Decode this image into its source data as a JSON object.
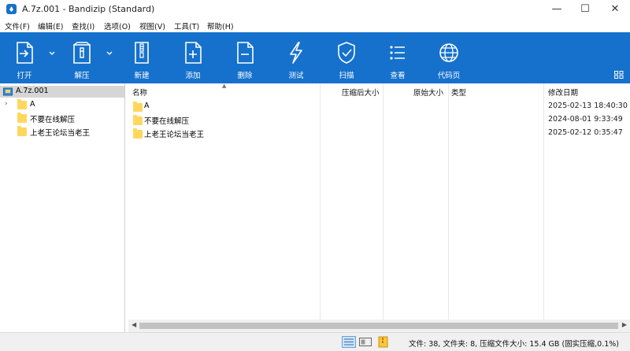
{
  "window": {
    "title": "A.7z.001 - Bandizip (Standard)",
    "minimize": "—",
    "maximize": "☐",
    "close": "✕"
  },
  "menu": [
    "文件(F)",
    "编辑(E)",
    "查找(I)",
    "选项(O)",
    "视图(V)",
    "工具(T)",
    "帮助(H)"
  ],
  "toolbar": {
    "open": "打开",
    "extract": "解压",
    "new": "新建",
    "add": "添加",
    "delete": "删除",
    "test": "测试",
    "scan": "扫描",
    "view": "查看",
    "codepage": "代码页"
  },
  "tree": {
    "root": "A.7z.001",
    "items": [
      "A",
      "不要在线解压",
      "上老王论坛当老王"
    ]
  },
  "columns": {
    "name": "名称",
    "compressed": "压缩后大小",
    "original": "原始大小",
    "type": "类型",
    "modified": "修改日期"
  },
  "files": [
    {
      "name": "A",
      "modified": "2025-02-13 18:40:30"
    },
    {
      "name": "不要在线解压",
      "modified": "2024-08-01 9:33:49"
    },
    {
      "name": "上老王论坛当老王",
      "modified": "2025-02-12 0:35:47"
    }
  ],
  "status": {
    "summary": "文件: 38, 文件夹: 8, 压缩文件大小: 15.4 GB (固实压缩,0.1%)"
  },
  "colors": {
    "toolbar_bg": "#1571cc",
    "folder": "#ffd75e",
    "selected_tree": "#d6d6d6"
  }
}
